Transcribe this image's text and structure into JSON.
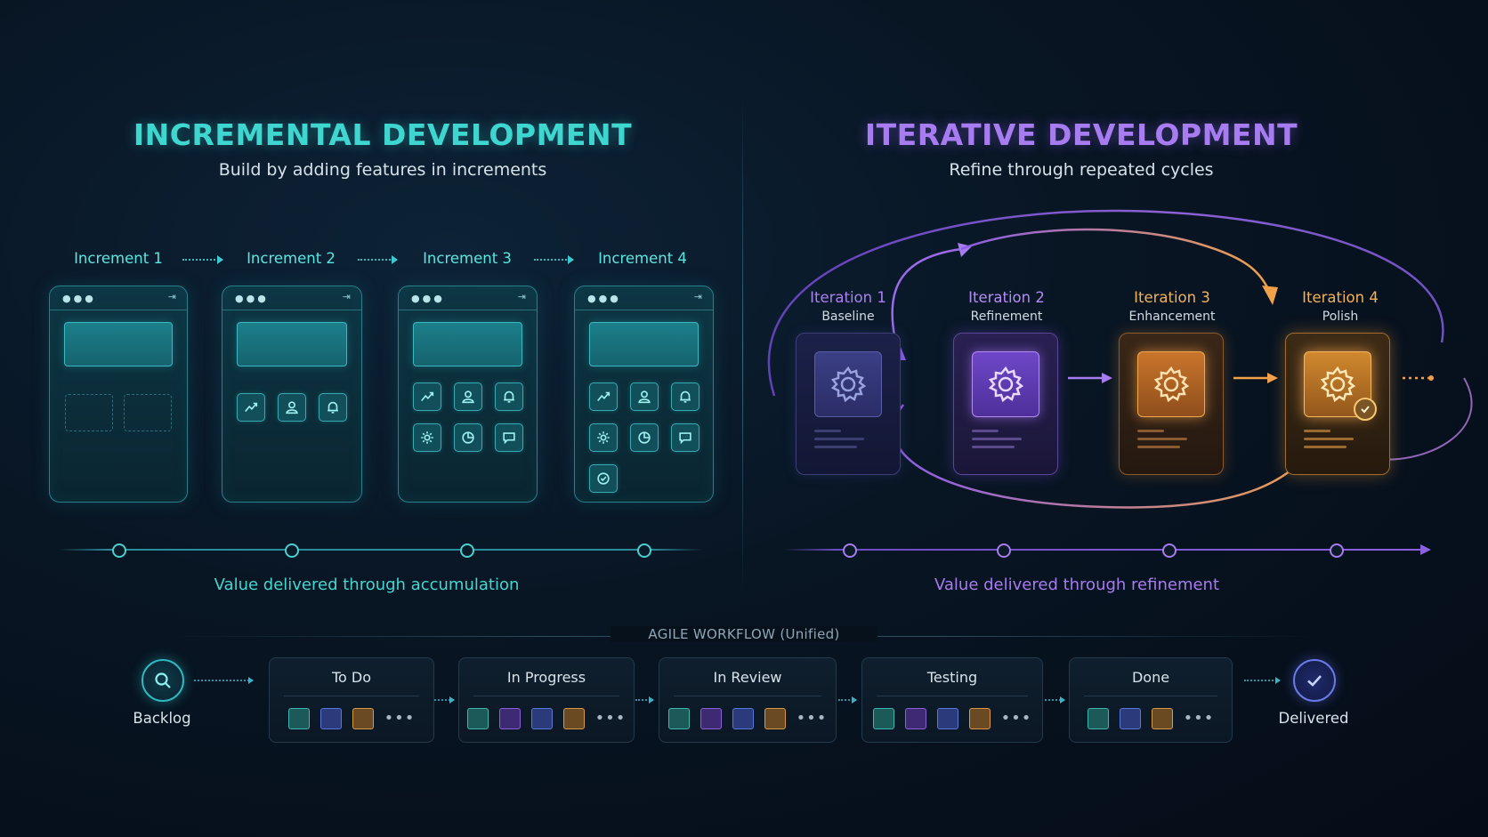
{
  "incremental": {
    "title": "INCREMENTAL DEVELOPMENT",
    "subtitle": "Build by adding features in increments",
    "increments": [
      "Increment 1",
      "Increment 2",
      "Increment 3",
      "Increment 4"
    ],
    "caption": "Value delivered through accumulation",
    "color": "#3fd6d0"
  },
  "iterative": {
    "title": "ITERATIVE DEVELOPMENT",
    "subtitle": "Refine through repeated cycles",
    "iterations": [
      {
        "name": "Iteration 1",
        "sub": "Baseline"
      },
      {
        "name": "Iteration 2",
        "sub": "Refinement"
      },
      {
        "name": "Iteration 3",
        "sub": "Enhancement"
      },
      {
        "name": "Iteration 4",
        "sub": "Polish"
      }
    ],
    "caption": "Value delivered through refinement",
    "color": "#a77cf0",
    "accent": "#f0a14a"
  },
  "workflow": {
    "title": "AGILE WORKFLOW (Unified)",
    "start": "Backlog",
    "end": "Delivered",
    "columns": [
      {
        "title": "To Do",
        "chips": [
          "teal",
          "blue",
          "orange"
        ]
      },
      {
        "title": "In Progress",
        "chips": [
          "teal",
          "purple",
          "blue",
          "orange"
        ]
      },
      {
        "title": "In Review",
        "chips": [
          "teal",
          "purple",
          "blue",
          "orange"
        ]
      },
      {
        "title": "Testing",
        "chips": [
          "teal",
          "purple",
          "blue",
          "orange"
        ]
      },
      {
        "title": "Done",
        "chips": [
          "teal",
          "blue",
          "orange"
        ]
      }
    ],
    "more": "•••"
  }
}
